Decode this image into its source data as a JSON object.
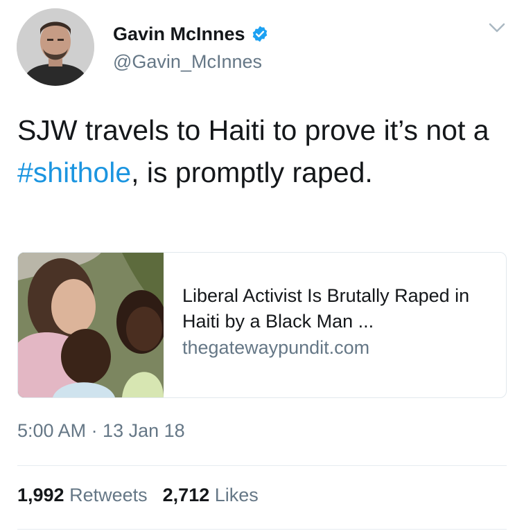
{
  "user": {
    "display_name": "Gavin McInnes",
    "handle": "@Gavin_McInnes",
    "verified_icon": "verified-badge-icon"
  },
  "tweet": {
    "text_before": "SJW travels to Haiti to prove it’s not a ",
    "hashtag": "#shithole",
    "text_after": ", is promptly raped."
  },
  "card": {
    "title": "Liberal Activist Is Brutally Raped in Haiti by a Black Man ...",
    "domain": "thegatewaypundit.com"
  },
  "meta": {
    "timestamp": "5:00 AM · 13 Jan 18"
  },
  "stats": {
    "retweets_count": "1,992",
    "retweets_label": "Retweets",
    "likes_count": "2,712",
    "likes_label": "Likes"
  },
  "colors": {
    "link": "#1b95e0",
    "secondary_text": "#657786",
    "primary_text": "#14171a"
  },
  "icons": [
    "verified-badge-icon",
    "chevron-down-icon"
  ]
}
